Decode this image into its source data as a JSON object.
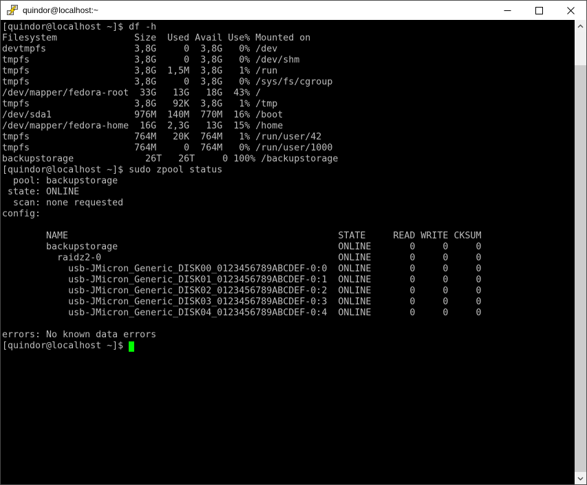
{
  "window": {
    "title": "quindor@localhost:~",
    "app_icon": "putty-terminal-icon",
    "controls": {
      "minimize": "Minimize",
      "maximize": "Maximize",
      "close": "Close"
    }
  },
  "terminal": {
    "prompt_line": "[quindor@localhost ~]$ ",
    "lines": [
      "[quindor@localhost ~]$ df -h",
      "Filesystem              Size  Used Avail Use% Mounted on",
      "devtmpfs                3,8G     0  3,8G   0% /dev",
      "tmpfs                   3,8G     0  3,8G   0% /dev/shm",
      "tmpfs                   3,8G  1,5M  3,8G   1% /run",
      "tmpfs                   3,8G     0  3,8G   0% /sys/fs/cgroup",
      "/dev/mapper/fedora-root  33G   13G   18G  43% /",
      "tmpfs                   3,8G   92K  3,8G   1% /tmp",
      "/dev/sda1               976M  140M  770M  16% /boot",
      "/dev/mapper/fedora-home  16G  2,3G   13G  15% /home",
      "tmpfs                   764M   20K  764M   1% /run/user/42",
      "tmpfs                   764M     0  764M   0% /run/user/1000",
      "backupstorage             26T   26T     0 100% /backupstorage",
      "[quindor@localhost ~]$ sudo zpool status",
      "  pool: backupstorage",
      " state: ONLINE",
      "  scan: none requested",
      "config:",
      "",
      "        NAME                                                 STATE     READ WRITE CKSUM",
      "        backupstorage                                        ONLINE       0     0     0",
      "          raidz2-0                                           ONLINE       0     0     0",
      "            usb-JMicron_Generic_DISK00_0123456789ABCDEF-0:0  ONLINE       0     0     0",
      "            usb-JMicron_Generic_DISK01_0123456789ABCDEF-0:1  ONLINE       0     0     0",
      "            usb-JMicron_Generic_DISK02_0123456789ABCDEF-0:2  ONLINE       0     0     0",
      "            usb-JMicron_Generic_DISK03_0123456789ABCDEF-0:3  ONLINE       0     0     0",
      "            usb-JMicron_Generic_DISK04_0123456789ABCDEF-0:4  ONLINE       0     0     0",
      "",
      "errors: No known data errors"
    ]
  },
  "colors": {
    "term-bg": "#000000",
    "term-fg": "#bbbbbb",
    "cursor": "#00ff00",
    "titlebar-bg": "#ffffff",
    "titlebar-fg": "#000000",
    "sb-track": "#f0f0f0",
    "sb-thumb": "#cdcdcd"
  }
}
